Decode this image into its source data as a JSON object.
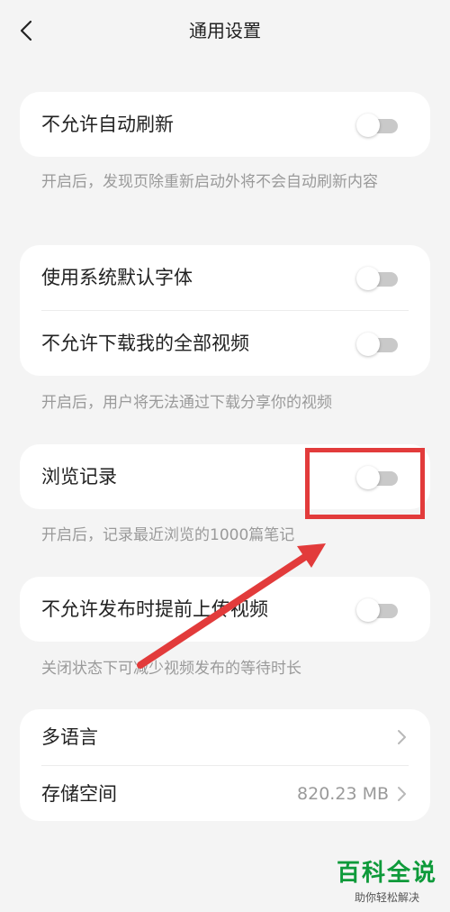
{
  "header": {
    "title": "通用设置"
  },
  "sections": [
    {
      "items": [
        {
          "label": "不允许自动刷新",
          "enabled": false
        }
      ],
      "hint": "开启后，发现页除重新启动外将不会自动刷新内容"
    },
    {
      "items": [
        {
          "label": "使用系统默认字体",
          "enabled": false
        },
        {
          "label": "不允许下载我的全部视频",
          "enabled": false
        }
      ],
      "hint": "开启后，用户将无法通过下载分享你的视频"
    },
    {
      "items": [
        {
          "label": "浏览记录",
          "enabled": false
        }
      ],
      "hint": "开启后，记录最近浏览的1000篇笔记"
    },
    {
      "items": [
        {
          "label": "不允许发布时提前上传视频",
          "enabled": false
        }
      ],
      "hint": "关闭状态下可减少视频发布的等待时长"
    }
  ],
  "links": [
    {
      "label": "多语言",
      "value": ""
    },
    {
      "label": "存储空间",
      "value": "820.23 MB"
    }
  ],
  "watermark": {
    "title": "百科全说",
    "subtitle": "助你轻松解决"
  },
  "annotation_color": "#e23b3b",
  "toggle_off_color": "#c9c9c9"
}
